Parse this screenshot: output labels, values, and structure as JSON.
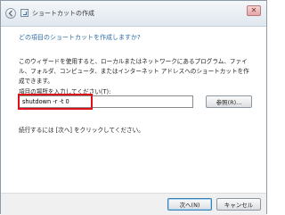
{
  "window": {
    "title": "ショートカットの作成",
    "back_icon": "back-arrow-icon",
    "close_label": "✕"
  },
  "content": {
    "question": "どの項目のショートカットを作成しますか?",
    "description": "このウィザードを使用すると、ローカルまたはネットワークにあるプログラム、ファイル、フォルダ、コンピュータ、またはインターネット アドレスへのショートカットを作成できます。",
    "location_label": "項目の場所を入力してください(T):",
    "location_value": "shutdown -r -t 0",
    "browse_label": "参照(R)...",
    "continue_text": "続行するには [次へ] をクリックしてください。"
  },
  "footer": {
    "next_label": "次へ(N)",
    "cancel_label": "キャンセル"
  },
  "colors": {
    "highlight": "#e0101a",
    "question_text": "#2d6ca6"
  }
}
